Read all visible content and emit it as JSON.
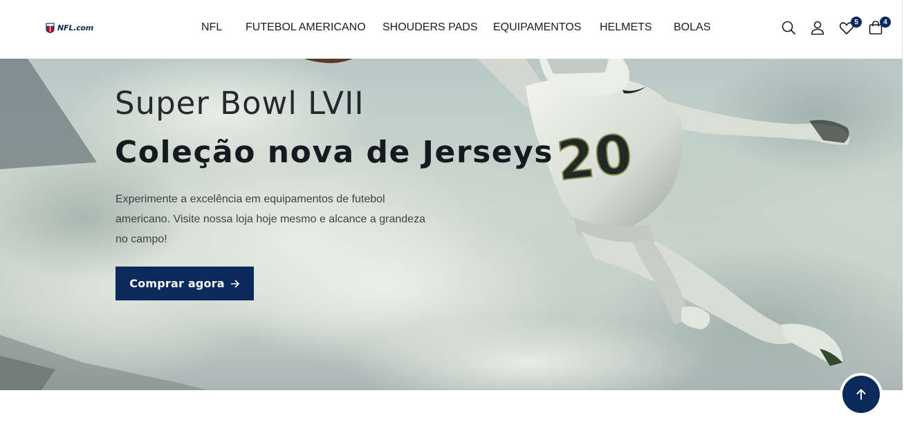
{
  "brand": {
    "logo_text": "NFL.com"
  },
  "nav": {
    "items": [
      {
        "label": "NFL"
      },
      {
        "label": "FUTEBOL AMERICANO"
      },
      {
        "label": "SHOUDERS PADS"
      },
      {
        "label": "EQUIPAMENTOS"
      },
      {
        "label": "HELMETS"
      },
      {
        "label": "BOLAS"
      }
    ]
  },
  "header_icons": {
    "search": "search-icon",
    "account": "user-icon",
    "wishlist": "heart-icon",
    "wishlist_count": "5",
    "cart": "bag-icon",
    "cart_count": "4"
  },
  "hero": {
    "subtitle": "Super Bowl LVII",
    "title": "Coleção nova de Jerseys",
    "description": "Experimente a excelência em equipamentos de futebol americano. Visite nossa loja hoje mesmo e alcance a grandeza no campo!",
    "cta_label": "Comprar agora",
    "jersey_number": "20"
  },
  "colors": {
    "brand_navy": "#0b2a5c",
    "text_dark": "#161a20",
    "hero_bg": "#c6d1cb"
  }
}
